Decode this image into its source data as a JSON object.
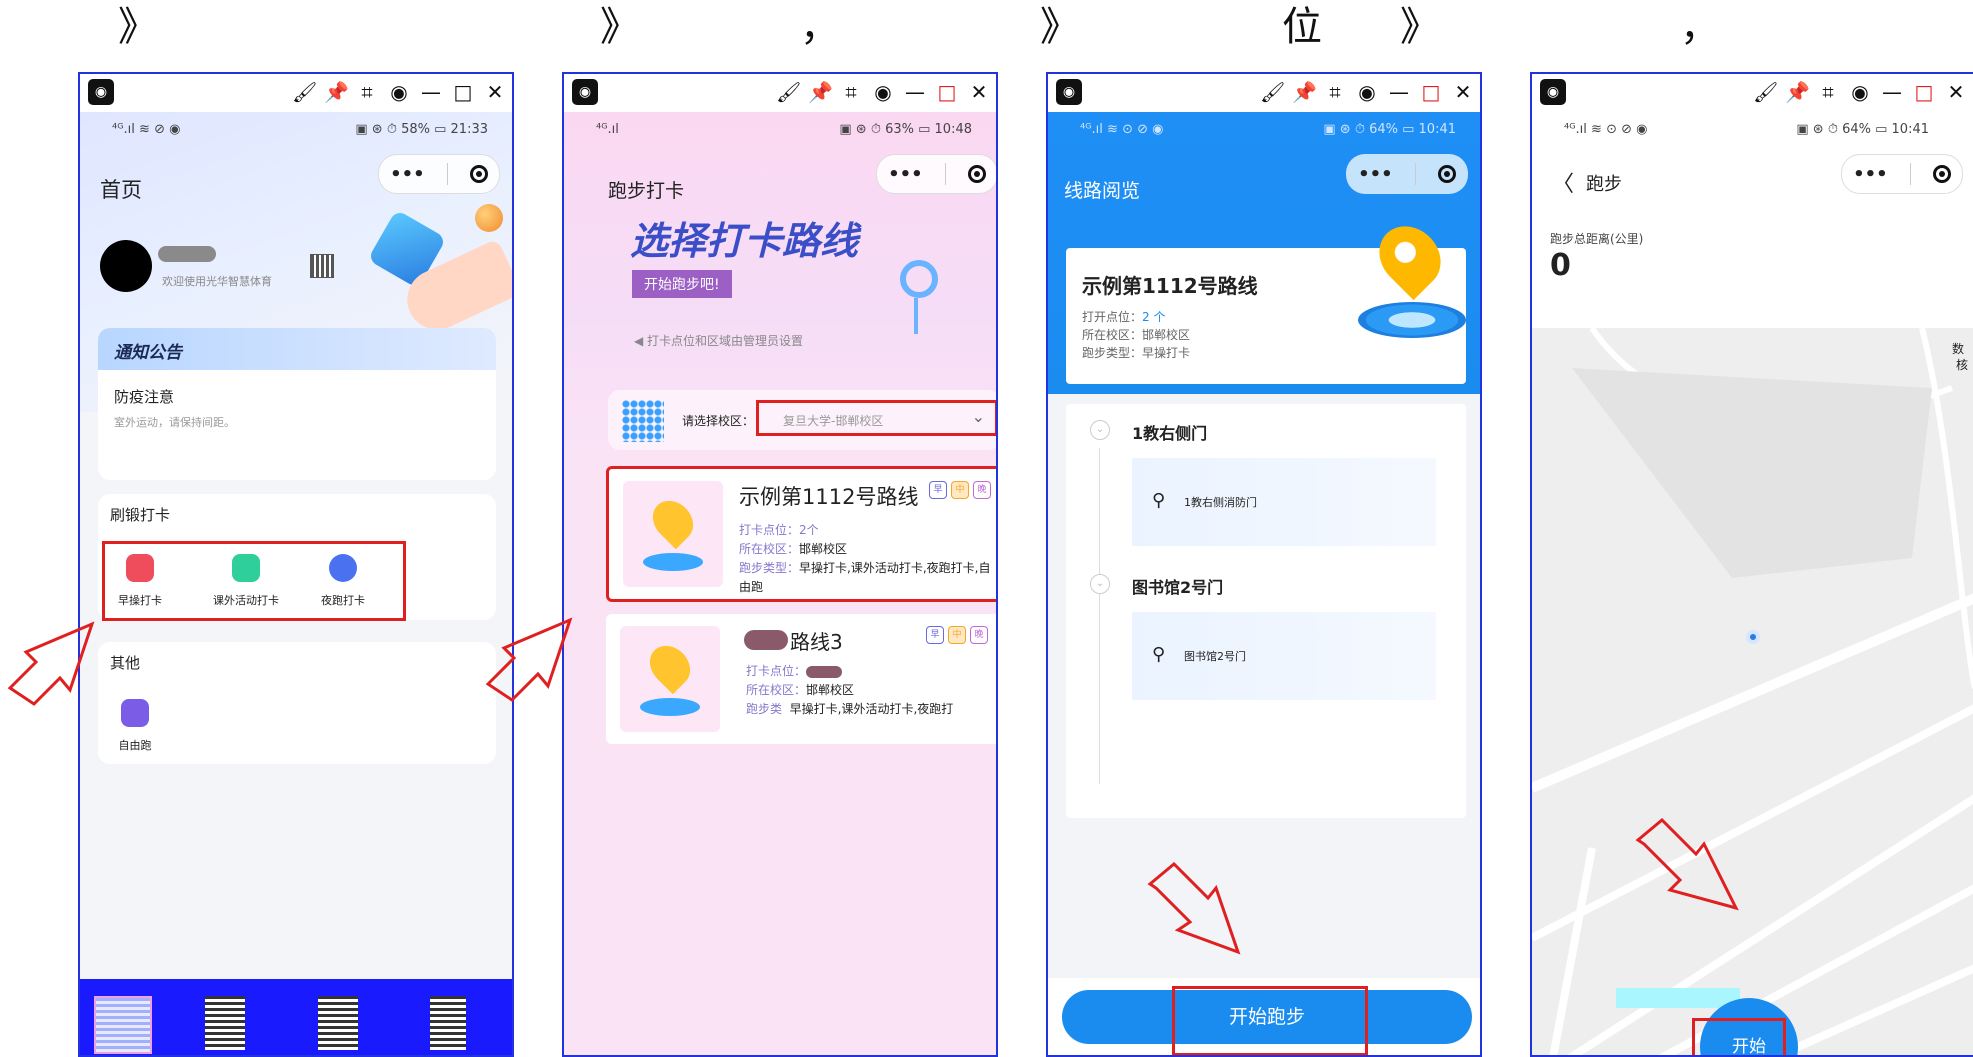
{
  "separators": [
    "》",
    "》",
    "，",
    "》",
    "位",
    "》",
    "，"
  ],
  "window_tools": [
    "🖌",
    "📌",
    "⌗",
    "◉",
    "—",
    "□",
    "✕"
  ],
  "phone1": {
    "status_left": "⁴ᴳ.ıl ≋ ⊘ ◉",
    "status_right": "▣ ⊛ ⏱ 58% ▭ 21:33",
    "title": "首页",
    "capsule_dots": "•••",
    "welcome": "欢迎使用光华智慧体育",
    "notice_header": "通知公告",
    "notice_title": "防疫注意",
    "notice_body": "室外运动，请保持间距。",
    "section_checkin": "刷锻打卡",
    "items": [
      {
        "label": "早操打卡",
        "color": "#ef4d5c"
      },
      {
        "label": "课外活动打卡",
        "color": "#2fcf9c"
      },
      {
        "label": "夜跑打卡",
        "color": "#4a72f0"
      }
    ],
    "section_other": "其他",
    "free_run": "自由跑",
    "free_run_color": "#7b5ce6"
  },
  "phone2": {
    "status_left": "⁴ᴳ.ıl",
    "status_right": "▣ ⊛ ⏱ 63% ▭ 10:48",
    "title": "跑步打卡",
    "banner_title": "选择打卡路线",
    "banner_button": "开始跑步吧!",
    "banner_note": "◀ 打卡点位和区域由管理员设置",
    "campus_label": "请选择校区：",
    "campus_value": "复旦大学-邯郸校区",
    "route1": {
      "name": "示例第1112号路线",
      "points_label": "打卡点位：",
      "points_value": "2个",
      "campus_label": "所在校区：",
      "campus_value": "邯郸校区",
      "type_label": "跑步类型：",
      "type_value": "早操打卡,课外活动打卡,夜跑打卡,自由跑",
      "tags": [
        "早",
        "中",
        "晚"
      ]
    },
    "route2": {
      "name": "路线3",
      "points_label": "打卡点位：",
      "campus_label": "所在校区：",
      "campus_value": "邯郸校区",
      "type_label": "跑步类",
      "type_value": "早操打卡,课外活动打卡,夜跑打",
      "tags": [
        "早",
        "中",
        "晚"
      ]
    }
  },
  "phone3": {
    "status_left": "⁴ᴳ.ıl ≋ ⊙ ⊘ ◉",
    "status_right": "▣ ⊛ ⏱ 64% ▭ 10:41",
    "title": "线路阅览",
    "route_name": "示例第1112号路线",
    "points_label": "打开点位：",
    "points_value": "2 个",
    "campus_label": "所在校区：",
    "campus_value": "邯郸校区",
    "type_label": "跑步类型：",
    "type_value": "早操打卡",
    "stops": [
      {
        "name": "1教右侧门",
        "detail": "1教右侧消防门"
      },
      {
        "name": "图书馆2号门",
        "detail": "图书馆2号门"
      }
    ],
    "start_button": "开始跑步"
  },
  "phone4": {
    "status_left": "⁴ᴳ.ıl ≋ ⊙ ⊘ ◉",
    "status_right": "▣ ⊛ ⏱ 64% ▭ 10:41",
    "back": "〈",
    "title": "跑步",
    "distance_label": "跑步总距离(公里)",
    "distance_value": "0",
    "map_label_1": "数",
    "map_label_2": "核",
    "start_button": "开始"
  },
  "colors": {
    "frame": "#2233dd",
    "highlight": "#e02020",
    "primary_blue": "#1a8cf0",
    "pink_bg": "#fbe3f6"
  }
}
